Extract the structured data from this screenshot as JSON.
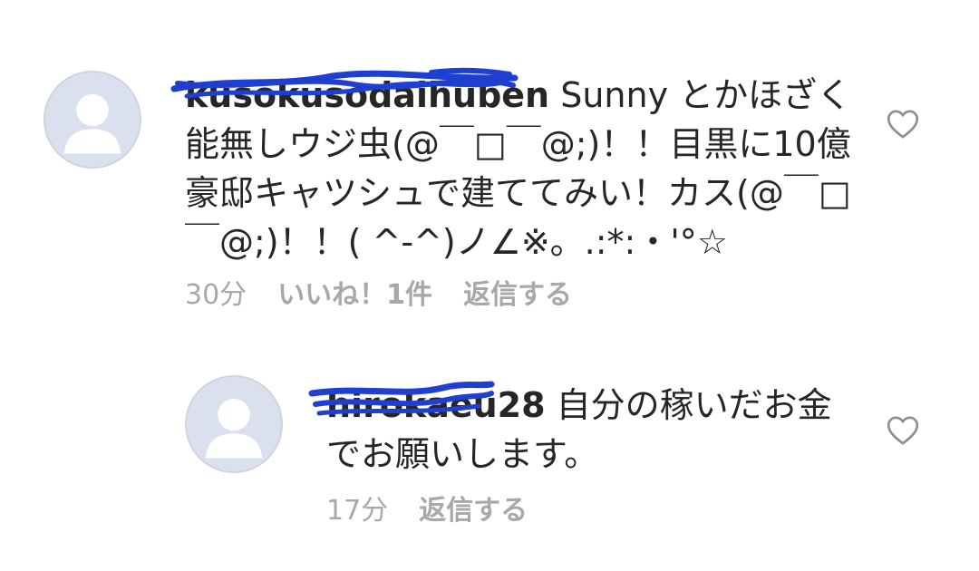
{
  "comments": [
    {
      "username": "kusokusodaihuben",
      "text": "Sunny とかほざく能無しウジ虫(@￣□￣@;)！！目黒に10億豪邸キャツシュで建ててみい！カス(@￣□￣@;)！！( ^-^)ノ∠※。.:*:・'°☆",
      "time": "30分",
      "likes": "いいね！1件",
      "reply": "返信する"
    },
    {
      "username": "hirokaeu28",
      "text": "自分の稼いだお金でお願いします。",
      "time": "17分",
      "reply": "返信する"
    }
  ],
  "colors": {
    "scribble": "#1f3fd1",
    "meta": "#a8a8a8",
    "avatar_bg": "#dbe0ee",
    "avatar_silhouette": "#ffffff"
  },
  "icons": {
    "avatar": "default-profile-icon",
    "like": "heart-outline-icon"
  }
}
